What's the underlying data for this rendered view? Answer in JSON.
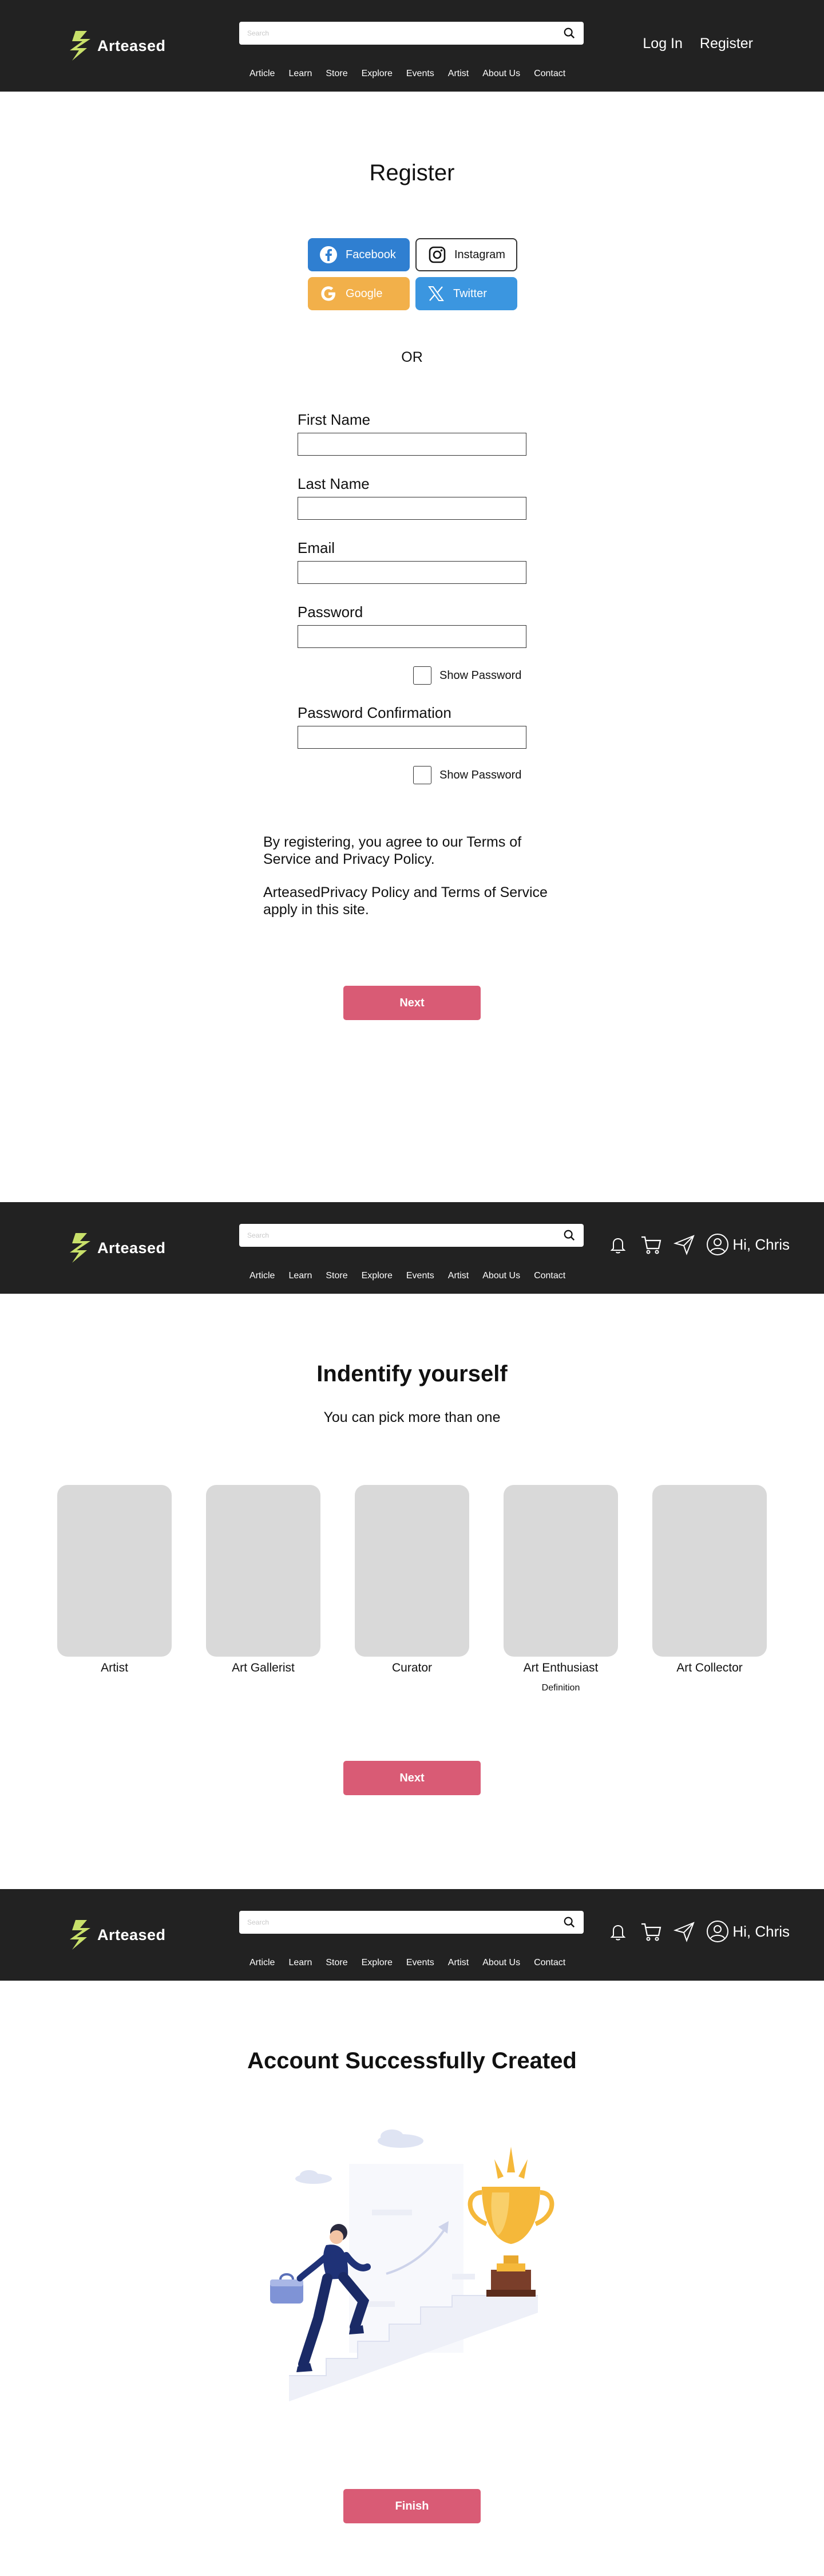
{
  "brand": {
    "name": "Arteased",
    "accent": "#c8e06a"
  },
  "header": {
    "search_placeholder": "Search",
    "nav": [
      "Article",
      "Learn",
      "Store",
      "Explore",
      "Events",
      "Artist",
      "About Us",
      "Contact"
    ],
    "login_label": "Log In",
    "register_label": "Register",
    "greeting": "Hi, Chris",
    "icons": [
      "bell-icon",
      "cart-icon",
      "send-icon",
      "user-icon"
    ]
  },
  "register": {
    "title": "Register",
    "social": [
      {
        "label": "Facebook",
        "icon": "facebook-icon",
        "color": "#2f7fd1"
      },
      {
        "label": "Instagram",
        "icon": "instagram-icon",
        "color": "#ffffff"
      },
      {
        "label": "Google",
        "icon": "google-icon",
        "color": "#f2b04a"
      },
      {
        "label": "Twitter",
        "icon": "twitter-x-icon",
        "color": "#3b96e0"
      }
    ],
    "or_label": "OR",
    "fields": {
      "first_name": "First Name",
      "last_name": "Last Name",
      "email": "Email",
      "password": "Password",
      "password_confirmation": "Password Confirmation"
    },
    "show_password": "Show Password",
    "terms_1": "By registering, you agree to our Terms of Service and Privacy Policy.",
    "terms_2": "ArteasedPrivacy Policy and Terms of Service apply in this site.",
    "next_label": "Next",
    "button_color": "#d95b75"
  },
  "identify": {
    "title": "Indentify yourself",
    "subtitle": "You can pick more than one",
    "roles": [
      {
        "label": "Artist",
        "sub": ""
      },
      {
        "label": "Art Gallerist",
        "sub": ""
      },
      {
        "label": "Curator",
        "sub": ""
      },
      {
        "label": "Art Enthusiast",
        "sub": "Definition"
      },
      {
        "label": "Art Collector",
        "sub": ""
      }
    ],
    "next_label": "Next"
  },
  "success": {
    "title": "Account Successfully Created",
    "finish_label": "Finish"
  }
}
